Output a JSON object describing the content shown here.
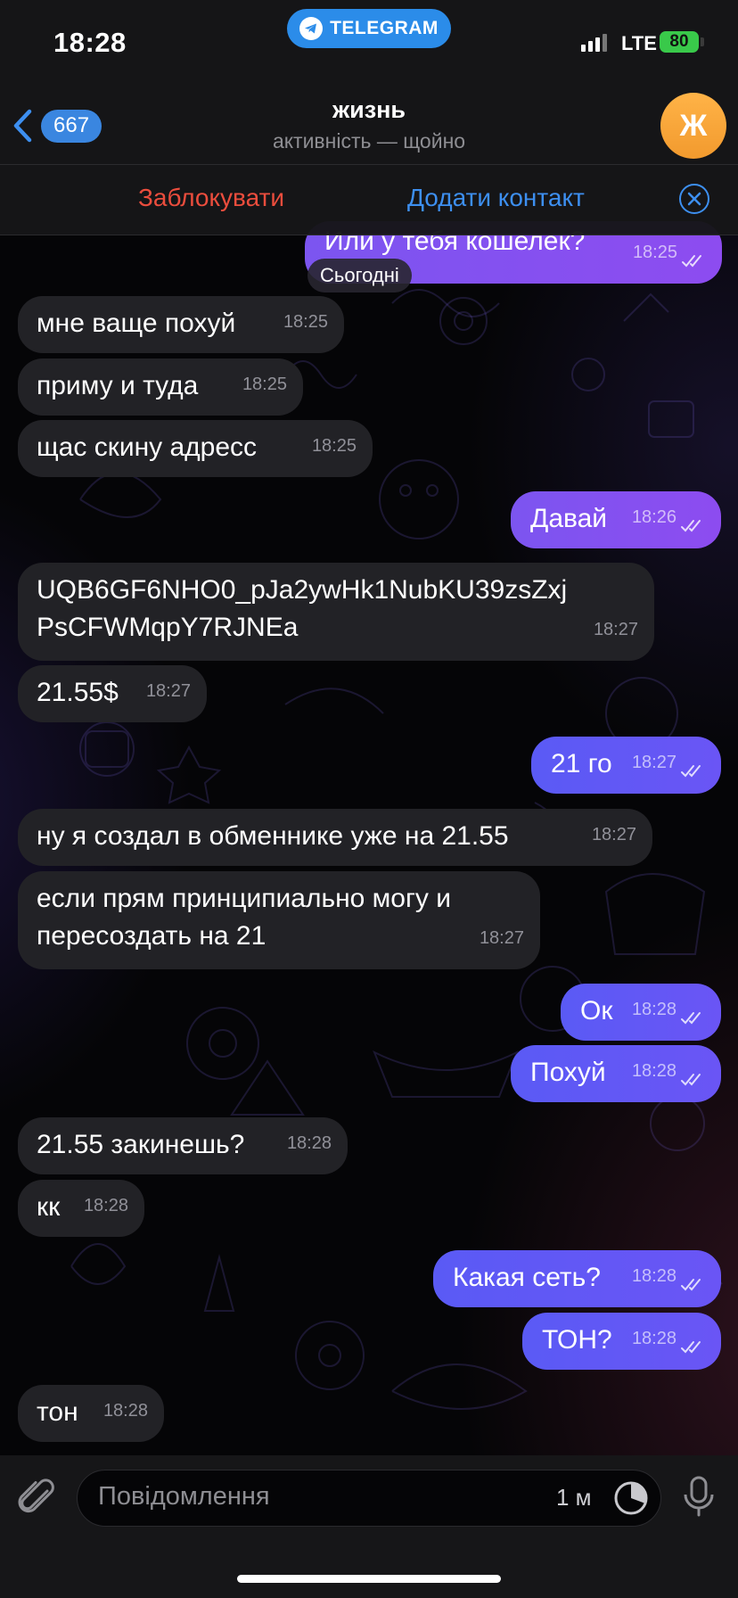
{
  "status_bar": {
    "time": "18:28",
    "app_pill": "TELEGRAM",
    "network": "LTE",
    "battery": "80"
  },
  "header": {
    "back_count": "667",
    "title": "жизнь",
    "subtitle": "активність — щойно",
    "avatar_letter": "Ж"
  },
  "actions": {
    "block": "Заблокувати",
    "add_contact": "Додати контакт"
  },
  "date_separator": "Сьогодні",
  "messages": [
    {
      "dir": "out",
      "text": "Или у тебя кошелек?",
      "time": "18:25",
      "read": true
    },
    {
      "dir": "in",
      "text": "мне ваще похуй",
      "time": "18:25"
    },
    {
      "dir": "in",
      "text": "приму и туда",
      "time": "18:25"
    },
    {
      "dir": "in",
      "text": "щас скину адресс",
      "time": "18:25"
    },
    {
      "dir": "out",
      "text": "Давай",
      "time": "18:26",
      "read": true
    },
    {
      "dir": "in",
      "text": "UQB6GF6NHO0_pJa2ywHk1NubKU39zsZxj\nPsCFWMqpY7RJNEa",
      "time": "18:27"
    },
    {
      "dir": "in",
      "text": "21.55$",
      "time": "18:27"
    },
    {
      "dir": "out",
      "text": "21 го",
      "time": "18:27",
      "read": true
    },
    {
      "dir": "in",
      "text": "ну я создал в обменнике уже на 21.55",
      "time": "18:27"
    },
    {
      "dir": "in",
      "text": "если прям принципиально могу и\nпересоздать на 21",
      "time": "18:27"
    },
    {
      "dir": "out",
      "text": "Ок",
      "time": "18:28",
      "read": true
    },
    {
      "dir": "out",
      "text": "Похуй",
      "time": "18:28",
      "read": true
    },
    {
      "dir": "in",
      "text": "21.55 закинешь?",
      "time": "18:28"
    },
    {
      "dir": "in",
      "text": "кк",
      "time": "18:28"
    },
    {
      "dir": "out",
      "text": "Какая сеть?",
      "time": "18:28",
      "read": true
    },
    {
      "dir": "out",
      "text": "ТОН?",
      "time": "18:28",
      "read": true
    },
    {
      "dir": "in",
      "text": "тон",
      "time": "18:28"
    }
  ],
  "composer": {
    "placeholder": "Повідомлення",
    "timer": "1 м"
  }
}
